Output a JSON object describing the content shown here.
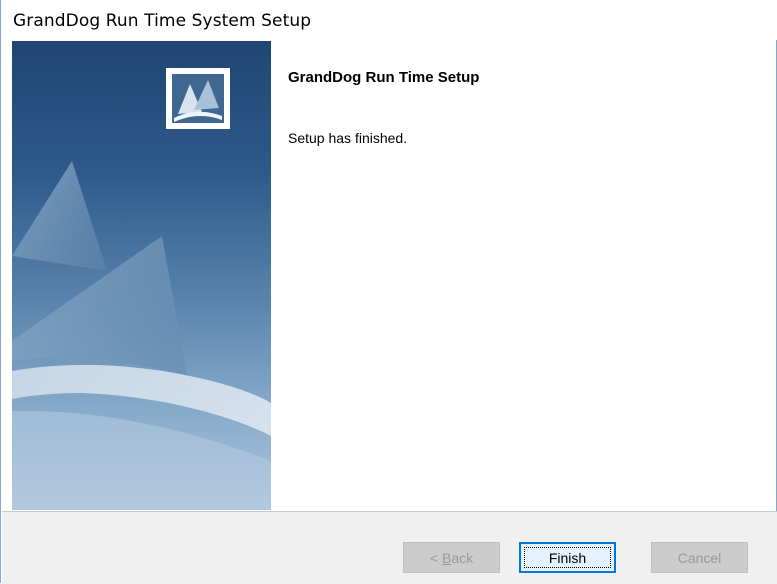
{
  "window": {
    "title": "GrandDog Run Time System Setup"
  },
  "content": {
    "heading": "GrandDog Run Time Setup",
    "message": "Setup has finished."
  },
  "buttons": {
    "back_prefix": "< ",
    "back_mnemonic": "B",
    "back_rest": "ack",
    "finish_label": "Finish",
    "cancel_label": "Cancel"
  },
  "icons": {
    "banner": "sail-tent-graphic",
    "logo": "setup-logo-icon"
  },
  "colors": {
    "banner_dark": "#1f4574",
    "banner_light": "#aec6dc",
    "default_button_border": "#0078d7",
    "button_bar": "#f0f0f0"
  }
}
